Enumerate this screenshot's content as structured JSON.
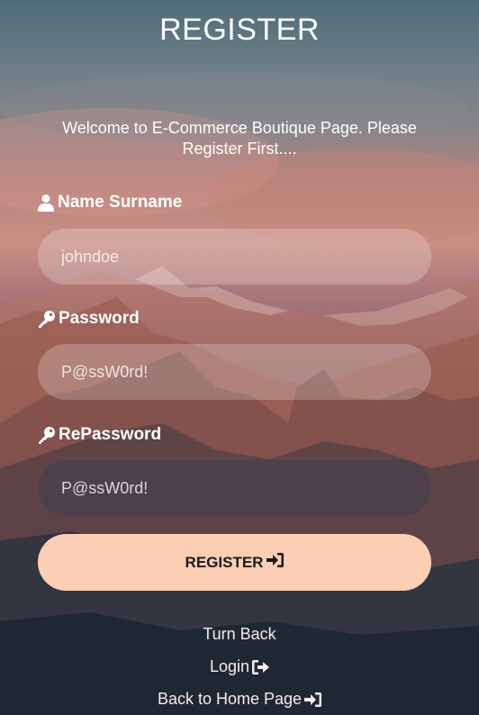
{
  "page": {
    "title": "REGISTER",
    "welcome_text": "Welcome to E-Commerce Boutique Page. Please Register First...."
  },
  "form": {
    "name": {
      "label": "Name Surname",
      "icon": "user-icon",
      "placeholder": "johndoe"
    },
    "password": {
      "label": "Password",
      "icon": "key-icon",
      "placeholder": "P@ssW0rd!"
    },
    "repassword": {
      "label": "RePassword",
      "icon": "key-icon",
      "placeholder": "P@ssW0rd!"
    },
    "submit": {
      "label": "REGISTER",
      "icon": "sign-in-icon"
    }
  },
  "links": {
    "turn_back": "Turn Back",
    "login": {
      "label": "Login",
      "icon": "sign-out-icon"
    },
    "home": {
      "label": "Back to Home Page",
      "icon": "sign-in-icon"
    }
  },
  "colors": {
    "button_bg": "#fccfb5",
    "button_text": "#1a1a1a",
    "text": "#ffffff"
  }
}
